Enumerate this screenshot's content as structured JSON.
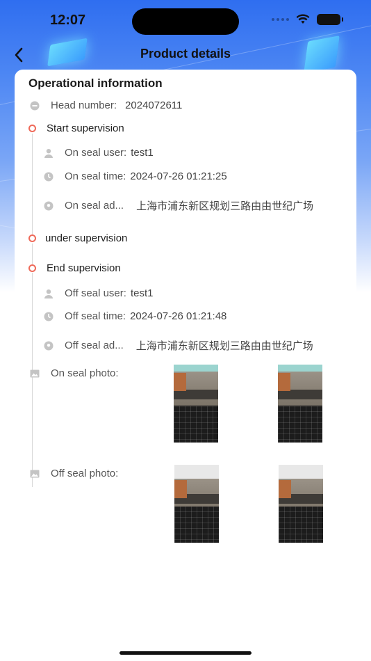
{
  "status_bar": {
    "time": "12:07"
  },
  "nav": {
    "title": "Product details"
  },
  "card": {
    "title": "Operational information",
    "head_number": {
      "label": "Head number:",
      "value": "2024072611"
    },
    "start": {
      "title": "Start supervision",
      "user": {
        "label": "On seal user:",
        "value": "test1"
      },
      "time": {
        "label": "On seal time:",
        "value": "2024-07-26 01:21:25"
      },
      "address": {
        "label": "On seal ad...",
        "value": "上海市浦东新区规划三路由由世纪广场"
      }
    },
    "under": {
      "title": "under supervision"
    },
    "end": {
      "title": "End supervision",
      "user": {
        "label": "Off seal user:",
        "value": "test1"
      },
      "time": {
        "label": "Off seal time:",
        "value": "2024-07-26 01:21:48"
      },
      "address": {
        "label": "Off seal ad...",
        "value": "上海市浦东新区规划三路由由世纪广场"
      }
    },
    "on_photo": {
      "label": "On seal photo:"
    },
    "off_photo": {
      "label": "Off seal photo:"
    }
  },
  "colors": {
    "accent_dot": "#ef6a5a",
    "header_blue": "#2f6ef0",
    "icon_gray": "#c4c4c4"
  },
  "icons": [
    "back-arrow-icon",
    "wifi-icon",
    "battery-icon",
    "minus-circle-icon",
    "user-icon",
    "clock-icon",
    "location-icon",
    "image-icon"
  ]
}
